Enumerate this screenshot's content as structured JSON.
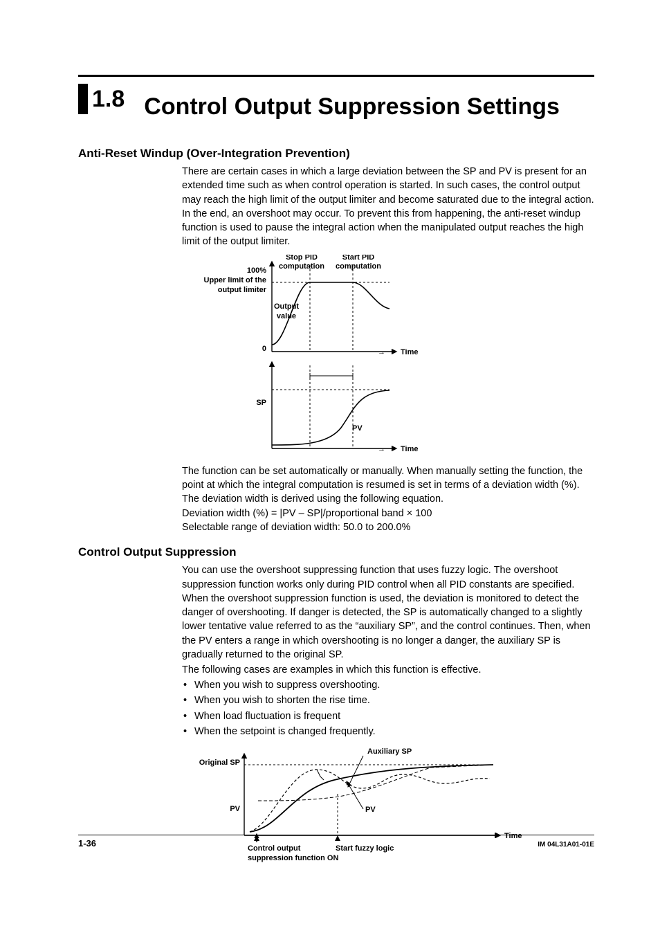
{
  "header": {
    "section_number": "1.8",
    "section_title": "Control Output Suppression Settings"
  },
  "anti_reset": {
    "heading": "Anti-Reset Windup (Over-Integration Prevention)",
    "para1": "There are certain cases in which a large deviation between the SP and PV is present for an extended time such as when control operation is started.  In such cases, the control output may reach the high limit of the output limiter and become saturated due to the integral action.  In the end, an overshoot may occur.  To prevent this from happening, the anti-reset windup function is used to pause the integral action when the manipulated output reaches the high limit of the output limiter.",
    "fig": {
      "stop_pid": "Stop PID",
      "start_pid": "Start PID",
      "computation": "computation",
      "hundred": "100%",
      "upper_limit_1": "Upper limit of the",
      "upper_limit_2": "output limiter",
      "output": "Output",
      "value": "value",
      "zero": "0",
      "time1": "Time",
      "sp": "SP",
      "pv": "PV",
      "time2": "Time"
    },
    "para2": "The function can be set automatically or manually.  When manually setting the function, the point at which the integral computation is resumed is set in terms of a deviation width (%).  The deviation width is derived using the following equation.",
    "eq": "Deviation width (%) = |PV – SP|/proportional band × 100",
    "range": "Selectable range of deviation width: 50.0 to 200.0%"
  },
  "cos": {
    "heading": "Control Output Suppression",
    "para1": "You can use the overshoot suppressing function that uses fuzzy logic.  The overshoot suppression function works only during PID control when all PID constants are specified.  When the overshoot suppression function is used, the deviation is monitored to detect the danger of overshooting.  If danger is detected, the SP is automatically changed to a slightly lower tentative value referred to as the “auxiliary SP”, and the control continues.  Then, when the PV enters a range in which overshooting is no longer a danger, the auxiliary SP is gradually returned to the original SP.",
    "para2": "The following cases are examples in which this function is effective.",
    "bullets": [
      "When you wish to suppress overshooting.",
      "When you wish to shorten the rise time.",
      "When load fluctuation is frequent",
      "When the setpoint is changed frequently."
    ],
    "fig": {
      "original_sp": "Original SP",
      "auxiliary_sp": "Auxiliary SP",
      "pv1": "PV",
      "pv2": "PV",
      "time": "Time",
      "ctrl_out_1": "Control output",
      "ctrl_out_2": "suppression function ON",
      "start_fuzzy": "Start fuzzy logic"
    }
  },
  "footer": {
    "page": "1-36",
    "doc_id": "IM 04L31A01-01E"
  }
}
